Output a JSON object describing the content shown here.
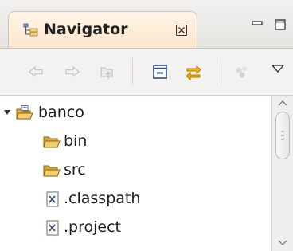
{
  "view": {
    "title": "Navigator",
    "close_symbol": "⊠",
    "colors": {
      "tab_active": "#fde6cc",
      "folder": "#d4a52a",
      "sync_arrows": "#e0a100"
    }
  },
  "toolbar": {
    "buttons": [
      {
        "name": "back-icon",
        "enabled": false
      },
      {
        "name": "forward-icon",
        "enabled": false
      },
      {
        "name": "up-folder-icon",
        "enabled": false
      },
      {
        "name": "collapse-all-icon",
        "enabled": true
      },
      {
        "name": "link-with-editor-icon",
        "enabled": true
      },
      {
        "name": "filter-icon",
        "enabled": false
      },
      {
        "name": "view-menu-icon",
        "enabled": true
      }
    ]
  },
  "tree": {
    "items": [
      {
        "label": "banco",
        "type": "project",
        "expanded": true
      },
      {
        "label": "bin",
        "type": "folder"
      },
      {
        "label": "src",
        "type": "folder"
      },
      {
        "label": ".classpath",
        "type": "xml-file"
      },
      {
        "label": ".project",
        "type": "xml-file"
      }
    ]
  }
}
